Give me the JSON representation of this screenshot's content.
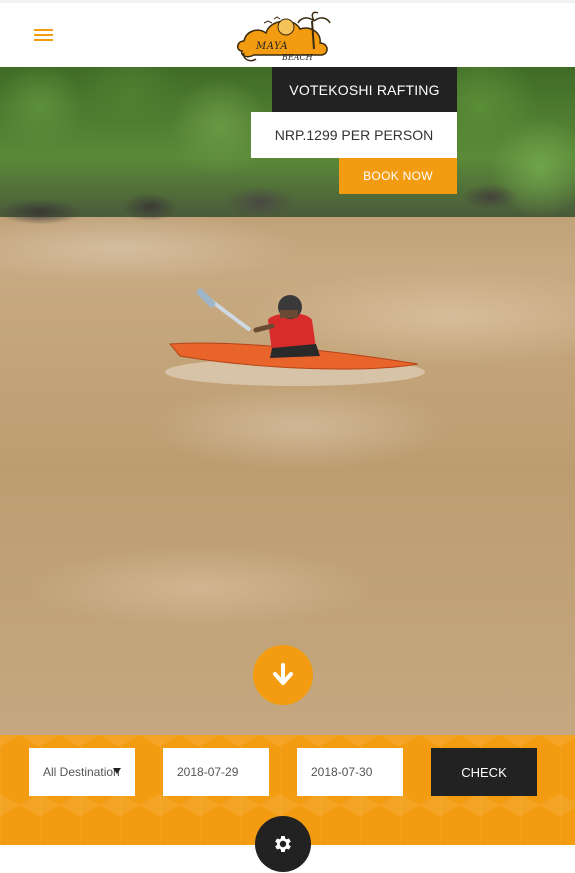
{
  "header": {
    "logo_line1": "MAYA",
    "logo_line2": "BEACH"
  },
  "hero": {
    "title": "VOTEKOSHI RAFTING",
    "price": "NRP.1299 PER PERSON",
    "book_label": "BOOK NOW"
  },
  "booking": {
    "destination_selected": "All Destination",
    "checkin_value": "2018-07-29",
    "checkout_value": "2018-07-30",
    "check_label": "CHECK"
  },
  "colors": {
    "accent": "#f39c12",
    "dark": "#222222",
    "white": "#ffffff"
  },
  "icons": {
    "menu": "menu-icon",
    "scroll_down": "arrow-down-icon",
    "settings": "gear-icon",
    "dropdown": "caret-down-icon"
  }
}
